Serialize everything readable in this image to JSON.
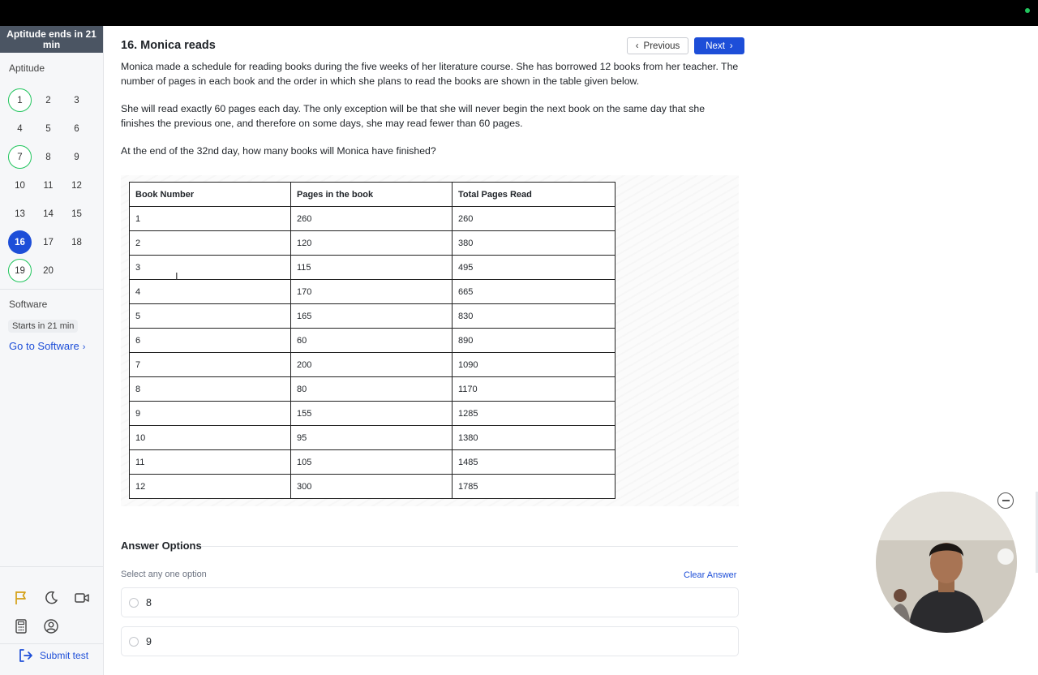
{
  "sidebar": {
    "timer": "Aptitude ends in 21 min",
    "section_aptitude": "Aptitude",
    "questions": [
      "1",
      "2",
      "3",
      "4",
      "5",
      "6",
      "7",
      "8",
      "9",
      "10",
      "11",
      "12",
      "13",
      "14",
      "15",
      "16",
      "17",
      "18",
      "19",
      "20"
    ],
    "answered": [
      "1",
      "7",
      "19"
    ],
    "current": "16",
    "section_software": "Software",
    "software_status": "Starts in 21 min",
    "goto_software": "Go to Software",
    "submit": "Submit test"
  },
  "header": {
    "title": "16. Monica reads",
    "prev": "Previous",
    "next": "Next"
  },
  "question": {
    "p1": "Monica made a schedule for reading books during the five weeks of her literature course. She has borrowed 12 books from her teacher. The number of pages in each book and the order in which she plans to read the books are shown in the table given below.",
    "p2": "She will read exactly 60 pages each day. The only exception will be that she will never begin the next book on the same day that she finishes the previous one, and therefore on some days, she may read fewer than 60 pages.",
    "p3": "At the end of the 32nd day, how many books will Monica have finished?"
  },
  "table": {
    "headers": [
      "Book Number",
      "Pages in the book",
      "Total Pages Read"
    ],
    "rows": [
      [
        "1",
        "260",
        "260"
      ],
      [
        "2",
        "120",
        "380"
      ],
      [
        "3",
        "115",
        "495"
      ],
      [
        "4",
        "170",
        "665"
      ],
      [
        "5",
        "165",
        "830"
      ],
      [
        "6",
        "60",
        "890"
      ],
      [
        "7",
        "200",
        "1090"
      ],
      [
        "8",
        "80",
        "1170"
      ],
      [
        "9",
        "155",
        "1285"
      ],
      [
        "10",
        "95",
        "1380"
      ],
      [
        "11",
        "105",
        "1485"
      ],
      [
        "12",
        "300",
        "1785"
      ]
    ]
  },
  "answers": {
    "heading": "Answer Options",
    "hint": "Select any one option",
    "clear": "Clear Answer",
    "options": [
      "8",
      "9"
    ]
  },
  "colors": {
    "accent": "#1d4ed8",
    "answered": "#22c55e",
    "timer_bg": "#4b5563"
  }
}
